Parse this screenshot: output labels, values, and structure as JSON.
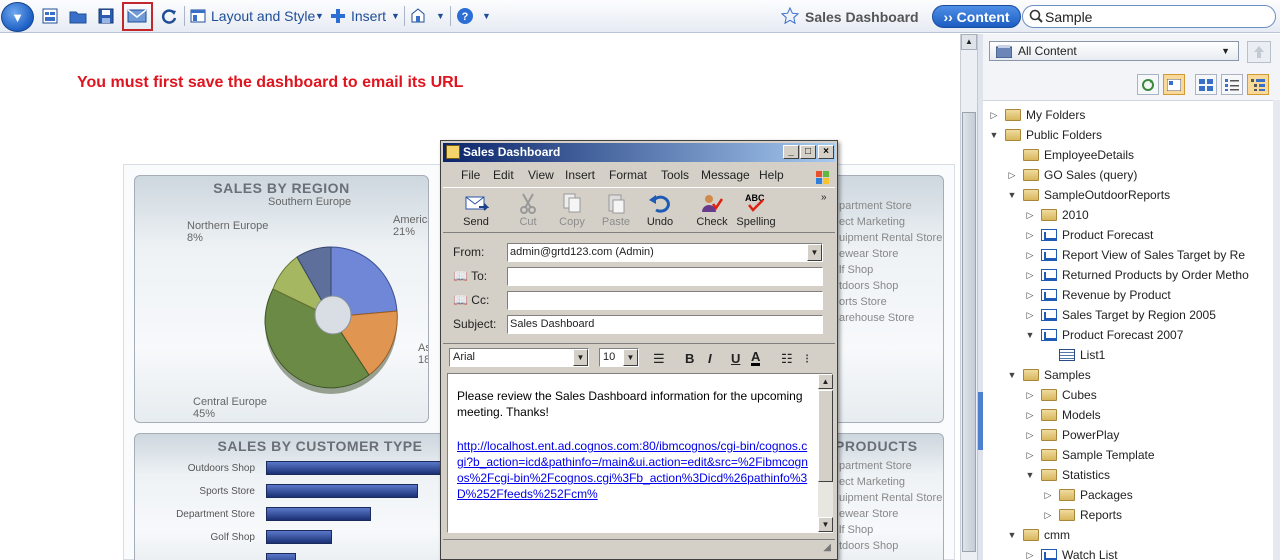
{
  "toolbar": {
    "menu_button_icon": "chevron-down-icon",
    "layout_label": "Layout and Style",
    "insert_label": "Insert",
    "dashboard_title": "Sales Dashboard",
    "content_button": "›› Content",
    "search_value": "Sample"
  },
  "dashboard": {
    "warning": "You must first save the dashboard to email its URL",
    "region_panel": {
      "title": "SALES BY REGION",
      "labels": [
        "Southern Europe",
        "Northern Europe",
        "8%",
        "Americas",
        "21%",
        "As",
        "18",
        "Central Europe",
        "45%"
      ]
    },
    "store_list_1": [
      "partment Store",
      "ect Marketing",
      "uipment Rental Store",
      "ewear Store",
      "lf Shop",
      "tdoors Shop",
      "orts Store",
      "arehouse Store"
    ],
    "customer_panel": {
      "title": "SALES BY CUSTOMER TYPE",
      "categories": [
        "Outdoors Shop",
        "Sports Store",
        "Department Store",
        "Golf Shop"
      ]
    },
    "products_title": "PRODUCTS",
    "store_list_2": [
      "partment Store",
      "ect Marketing",
      "uipment Rental Store",
      "ewear Store",
      "lf Shop",
      "tdoors Shop"
    ]
  },
  "email_dialog": {
    "title": "Sales Dashboard",
    "menus": [
      "File",
      "Edit",
      "View",
      "Insert",
      "Format",
      "Tools",
      "Message",
      "Help"
    ],
    "tools": [
      {
        "label": "Send",
        "enabled": true
      },
      {
        "label": "Cut",
        "enabled": false
      },
      {
        "label": "Copy",
        "enabled": false
      },
      {
        "label": "Paste",
        "enabled": false
      },
      {
        "label": "Undo",
        "enabled": true
      },
      {
        "label": "Check",
        "enabled": true
      },
      {
        "label": "Spelling",
        "enabled": true
      }
    ],
    "from_label": "From:",
    "from_value": "admin@grtd123.com    (Admin)",
    "to_label": "To:",
    "cc_label": "Cc:",
    "subject_label": "Subject:",
    "subject_value": "Sales Dashboard",
    "font_name": "Arial",
    "font_size": "10",
    "spelling_icon_text": "ABC",
    "body_text": "Please review the Sales Dashboard information for the upcoming meeting. Thanks!",
    "body_link": "http://localhost.ent.ad.cognos.com:80/ibmcognos/cgi-bin/cognos.cgi?b_action=icd&pathinfo=/main&ui.action=edit&src=%2Fibmcognos%2Fcgi-bin%2Fcognos.cgi%3Fb_action%3Dicd%26pathinfo%3D%252Ffeeds%252Fcm%"
  },
  "content_pane": {
    "dropdown_value": "All Content",
    "tree": [
      {
        "label": "My Folders",
        "depth": 0,
        "state": "collapsed",
        "icon": "my-folders-icon"
      },
      {
        "label": "Public Folders",
        "depth": 0,
        "state": "expanded",
        "icon": "public-folders-icon"
      },
      {
        "label": "EmployeeDetails",
        "depth": 1,
        "state": "none",
        "icon": "folder-icon"
      },
      {
        "label": "GO Sales (query)",
        "depth": 1,
        "state": "collapsed",
        "icon": "package-icon"
      },
      {
        "label": "SampleOutdoorReports",
        "depth": 1,
        "state": "expanded",
        "icon": "folder-icon"
      },
      {
        "label": "2010",
        "depth": 2,
        "state": "collapsed",
        "icon": "folder-icon"
      },
      {
        "label": "Product Forecast",
        "depth": 2,
        "state": "collapsed",
        "icon": "report-icon"
      },
      {
        "label": "Report View of Sales Target by Re",
        "depth": 2,
        "state": "collapsed",
        "icon": "report-view-icon"
      },
      {
        "label": "Returned Products by Order Metho",
        "depth": 2,
        "state": "collapsed",
        "icon": "report-icon"
      },
      {
        "label": "Revenue by Product",
        "depth": 2,
        "state": "collapsed",
        "icon": "report-icon"
      },
      {
        "label": "Sales Target by Region 2005",
        "depth": 2,
        "state": "collapsed",
        "icon": "report-icon"
      },
      {
        "label": "Product Forecast 2007",
        "depth": 2,
        "state": "expanded",
        "icon": "report-icon"
      },
      {
        "label": "List1",
        "depth": 3,
        "state": "none",
        "icon": "list-icon"
      },
      {
        "label": "Samples",
        "depth": 1,
        "state": "expanded",
        "icon": "folder-icon"
      },
      {
        "label": "Cubes",
        "depth": 2,
        "state": "collapsed",
        "icon": "folder-icon"
      },
      {
        "label": "Models",
        "depth": 2,
        "state": "collapsed",
        "icon": "folder-icon"
      },
      {
        "label": "PowerPlay",
        "depth": 2,
        "state": "collapsed",
        "icon": "folder-icon"
      },
      {
        "label": "Sample Template",
        "depth": 2,
        "state": "collapsed",
        "icon": "folder-icon"
      },
      {
        "label": "Statistics",
        "depth": 2,
        "state": "expanded",
        "icon": "folder-icon"
      },
      {
        "label": "Packages",
        "depth": 3,
        "state": "collapsed",
        "icon": "folder-icon"
      },
      {
        "label": "Reports",
        "depth": 3,
        "state": "collapsed",
        "icon": "folder-icon"
      },
      {
        "label": "cmm",
        "depth": 1,
        "state": "expanded",
        "icon": "package-icon"
      },
      {
        "label": "Watch List",
        "depth": 2,
        "state": "collapsed",
        "icon": "watch-list-icon"
      }
    ]
  },
  "colors": {
    "warning_red": "#e0141e",
    "toolbar_blue": "#1f4e96",
    "highlight_border": "#c1272d",
    "dialog_title_start": "#0a246a",
    "link": "#0000ee"
  }
}
